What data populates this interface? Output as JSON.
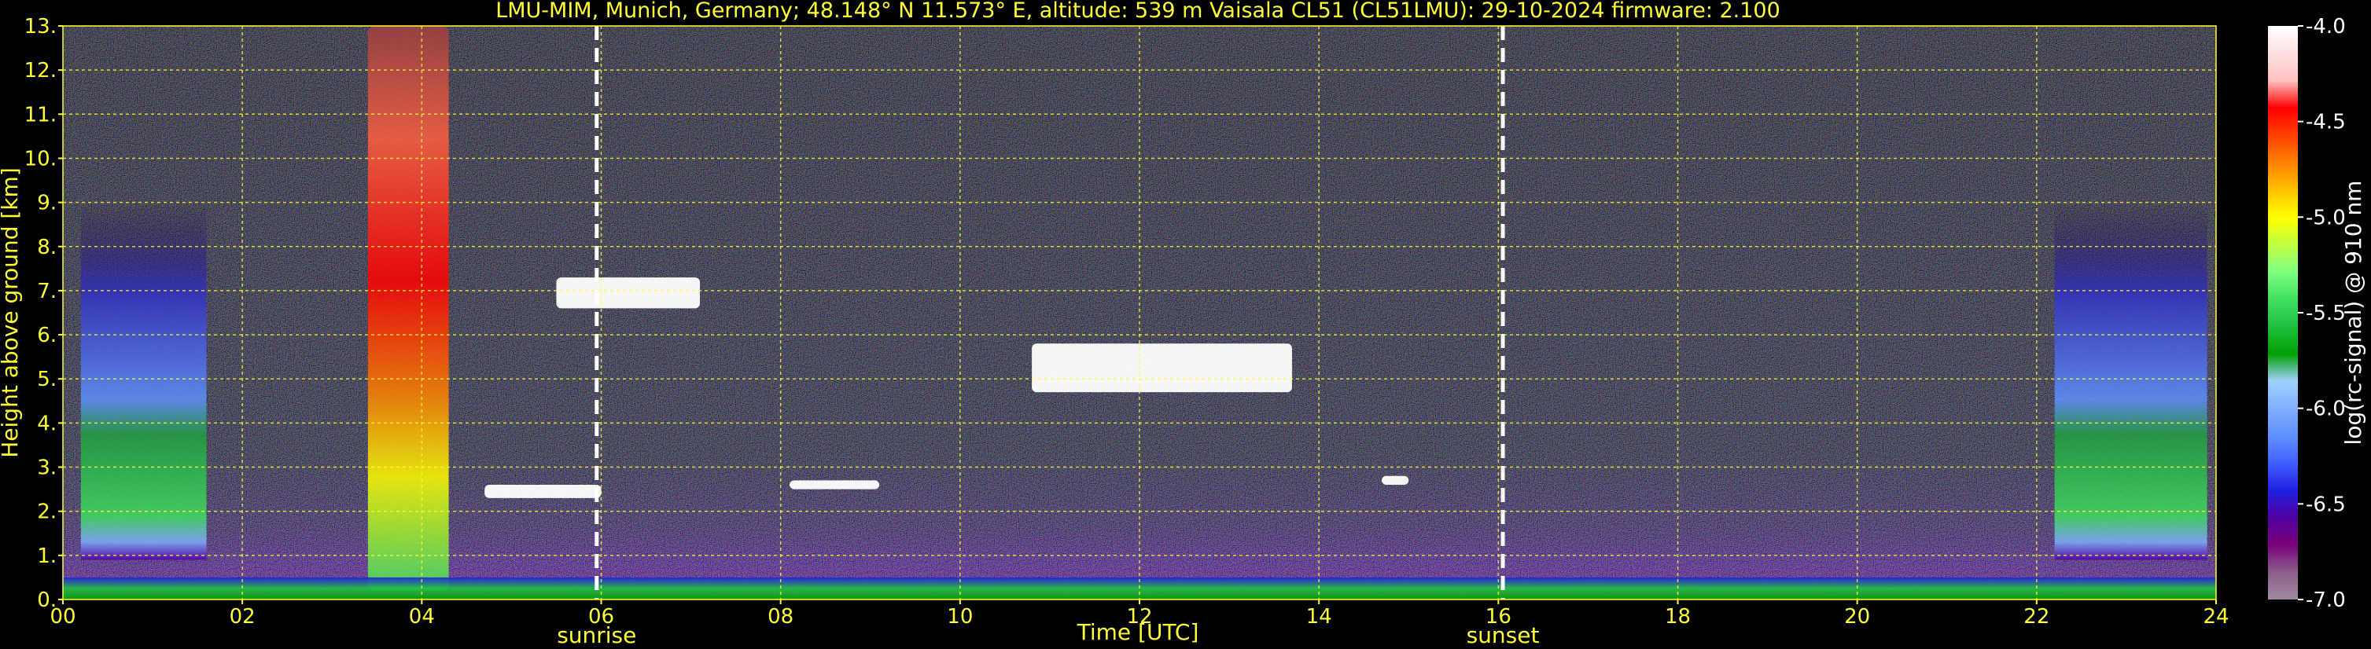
{
  "chart_data": {
    "type": "heatmap",
    "title": "LMU-MIM, Munich, Germany; 48.148° N 11.573° E, altitude: 539 m    Vaisala CL51 (CL51LMU): 29-10-2024    firmware: 2.100",
    "xlabel": "Time [UTC]",
    "ylabel": "Height above ground [km]",
    "xlim": [
      0,
      24
    ],
    "ylim": [
      0,
      13
    ],
    "x_ticks": [
      "00",
      "02",
      "04",
      "06",
      "08",
      "10",
      "12",
      "14",
      "16",
      "18",
      "20",
      "22",
      "24"
    ],
    "y_ticks": [
      "0.",
      "1.",
      "2.",
      "3.",
      "4.",
      "5.",
      "6.",
      "7.",
      "8.",
      "9.",
      "10.",
      "11.",
      "12.",
      "13."
    ],
    "grid": true,
    "events": [
      {
        "label": "sunrise",
        "x": 5.95
      },
      {
        "label": "sunset",
        "x": 16.05
      }
    ],
    "colorbar": {
      "label": "log(rc-signal) @ 910 nm",
      "range": [
        -7.0,
        -4.0
      ],
      "ticks": [
        "-4.0",
        "-4.5",
        "-5.0",
        "-5.5",
        "-6.0",
        "-6.5",
        "-7.0"
      ],
      "colors": [
        "#a08aa0",
        "#8a5f8a",
        "#7a007a",
        "#5000a0",
        "#2020e0",
        "#4060ff",
        "#6090ff",
        "#80b0ff",
        "#a0d0ff",
        "#00a000",
        "#20c040",
        "#40e060",
        "#80ff80",
        "#c0ff40",
        "#ffff00",
        "#ffc000",
        "#ff8000",
        "#ff4000",
        "#ff0000",
        "#ffc0c0",
        "#ffe0e0",
        "#ffffff"
      ]
    },
    "features": [
      {
        "name": "aerosol column",
        "x": [
          0.2,
          1.6
        ],
        "y": [
          0.9,
          9.0
        ]
      },
      {
        "name": "precipitation/cloud column",
        "x": [
          3.4,
          4.3
        ],
        "y": [
          0.2,
          13.0
        ]
      },
      {
        "name": "cloud layer",
        "x": [
          4.7,
          6.0
        ],
        "y": [
          2.3,
          2.6
        ]
      },
      {
        "name": "cloud layer",
        "x": [
          5.5,
          7.1
        ],
        "y": [
          6.6,
          7.3
        ]
      },
      {
        "name": "cloud layer",
        "x": [
          8.1,
          9.1
        ],
        "y": [
          2.5,
          2.7
        ]
      },
      {
        "name": "cloud layer",
        "x": [
          10.8,
          13.7
        ],
        "y": [
          4.7,
          5.8
        ]
      },
      {
        "name": "cloud layer",
        "x": [
          14.7,
          15.0
        ],
        "y": [
          2.6,
          2.8
        ]
      },
      {
        "name": "aerosol column",
        "x": [
          22.2,
          23.9
        ],
        "y": [
          0.9,
          9.0
        ]
      },
      {
        "name": "boundary layer",
        "x": [
          0.0,
          24.0
        ],
        "y": [
          0.0,
          0.5
        ]
      }
    ]
  }
}
